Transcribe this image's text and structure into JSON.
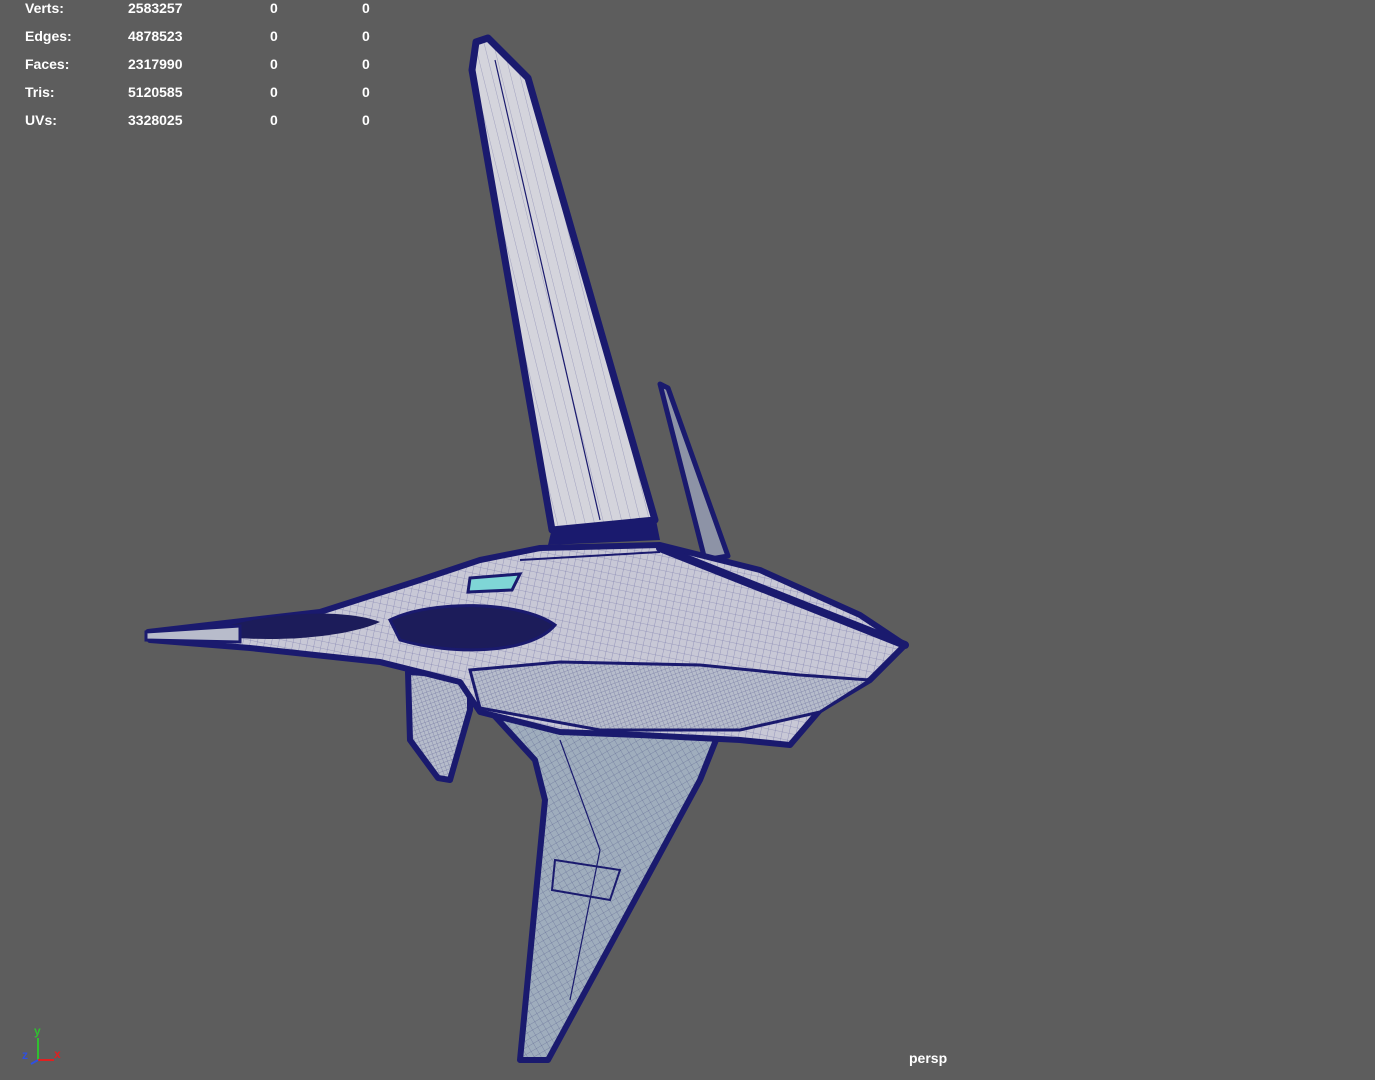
{
  "hud": {
    "rows": [
      {
        "label": "Verts:",
        "total": "2583257",
        "selected": "0",
        "components": "0"
      },
      {
        "label": "Edges:",
        "total": "4878523",
        "selected": "0",
        "components": "0"
      },
      {
        "label": "Faces:",
        "total": "2317990",
        "selected": "0",
        "components": "0"
      },
      {
        "label": "Tris:",
        "total": "5120585",
        "selected": "0",
        "components": "0"
      },
      {
        "label": "UVs:",
        "total": "3328025",
        "selected": "0",
        "components": "0"
      }
    ]
  },
  "viewport": {
    "camera": "persp",
    "background_color": "#5d5d5d",
    "wire_color": "#1a1a6e",
    "surface_color": "#c9c9d6"
  },
  "axis_gizmo": {
    "x_label": "x",
    "y_label": "y",
    "z_label": "z",
    "x_color": "#e02020",
    "y_color": "#30c030",
    "z_color": "#3050e0"
  }
}
